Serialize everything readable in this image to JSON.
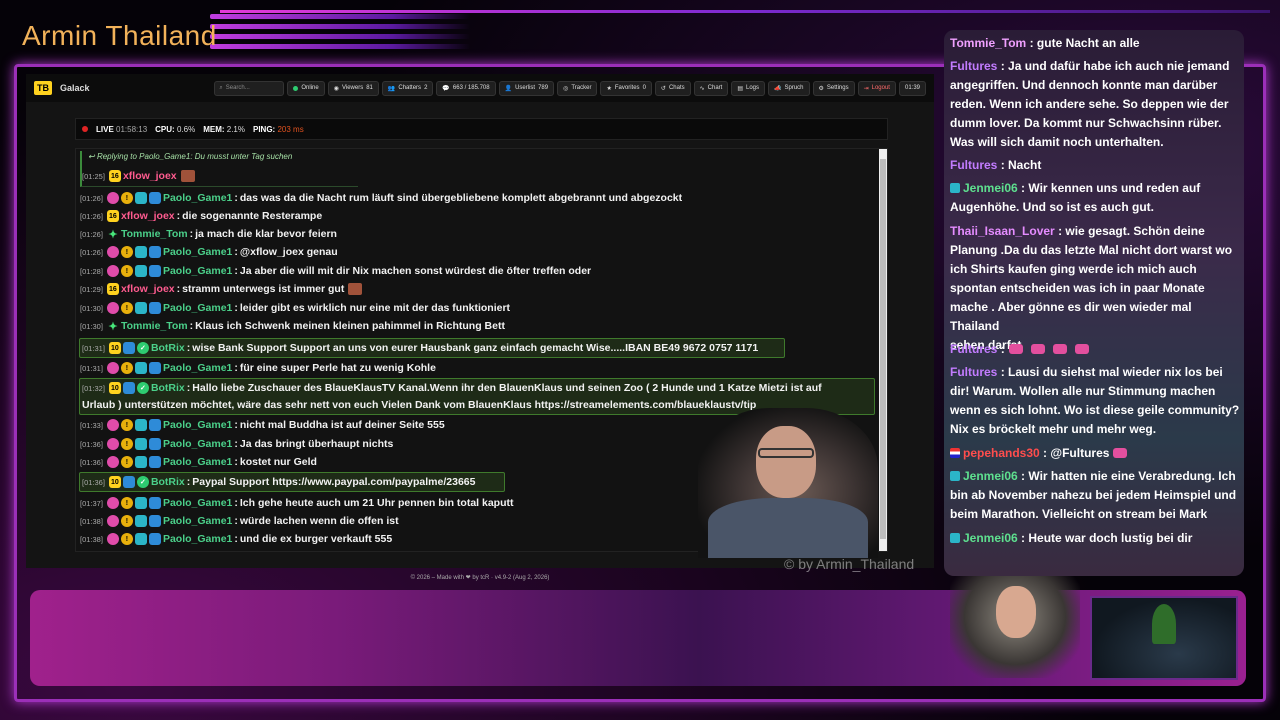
{
  "overlay": {
    "channel_title": "Armin Thailand",
    "watermark": "© by Armin_Thailand"
  },
  "app": {
    "brand": "Galack",
    "brand_logo": "TB",
    "search_placeholder": "Search...",
    "nav": {
      "online": "Online",
      "viewers": "Viewers",
      "viewers_count": "81",
      "chatters": "Chatters",
      "chatters_count": "2",
      "messages": "663 / 185.708",
      "userlist": "Userlist",
      "userlist_count": "789",
      "tracker": "Tracker",
      "favorites": "Favorites",
      "favorites_count": "0",
      "chats": "Chats",
      "chart": "Chart",
      "logs": "Logs",
      "spruch": "Spruch",
      "settings": "Settings",
      "logout": "Logout",
      "clock": "01:39"
    },
    "status": {
      "live": "LIVE",
      "live_time": "01:58:13",
      "cpu_label": "CPU:",
      "cpu_value": "0.6%",
      "mem_label": "MEM:",
      "mem_value": "2.1%",
      "ping_label": "PING:",
      "ping_value": "203 ms"
    },
    "reply": "Replying to Paolo_Game1: Du musst unter Tag suchen",
    "messages": [
      {
        "time": "[01:25]",
        "user": "xflow_joex",
        "text": ""
      },
      {
        "time": "[01:26]",
        "user": "Paolo_Game1",
        "text": "das was da die Nacht rum läuft sind übergebliebene komplett abgebrannt und abgezockt"
      },
      {
        "time": "[01:26]",
        "user": "xflow_joex",
        "text": "die sogenannte Resterampe"
      },
      {
        "time": "[01:26]",
        "user": "Tommie_Tom",
        "text": "ja mach die klar bevor feiern"
      },
      {
        "time": "[01:26]",
        "user": "Paolo_Game1",
        "text": "@xflow_joex genau"
      },
      {
        "time": "[01:28]",
        "user": "Paolo_Game1",
        "text": "Ja aber die will mit dir Nix machen sonst würdest die öfter treffen oder"
      },
      {
        "time": "[01:29]",
        "user": "xflow_joex",
        "text": "stramm unterwegs ist immer gut"
      },
      {
        "time": "[01:30]",
        "user": "Paolo_Game1",
        "text": "leider gibt es wirklich nur eine mit der das funktioniert"
      },
      {
        "time": "[01:30]",
        "user": "Tommie_Tom",
        "text": "Klaus ich Schwenk meinen kleinen pahimmel in Richtung Bett"
      },
      {
        "time": "[01:31]",
        "user": "BotRix",
        "text": "wise Bank Support Support an uns von eurer Hausbank ganz einfach gemacht Wise.....IBAN BE49 9672 0757 1171"
      },
      {
        "time": "[01:31]",
        "user": "Paolo_Game1",
        "text": "für eine super Perle hat zu wenig Kohle"
      },
      {
        "time": "[01:32]",
        "user": "BotRix",
        "text": "Hallo liebe Zuschauer des BlaueKlausTV Kanal.Wenn ihr den BlauenKlaus und seinen Zoo ( 2 Hunde und 1 Katze Mietzi ist auf",
        "text2": "Urlaub ) unterstützen möchtet, wäre das sehr nett von euch Vielen Dank vom BlauenKlaus https://streamelements.com/blaueklaustv/tip"
      },
      {
        "time": "[01:33]",
        "user": "Paolo_Game1",
        "text": "nicht mal Buddha ist auf deiner Seite 555"
      },
      {
        "time": "[01:36]",
        "user": "Paolo_Game1",
        "text": "Ja das bringt überhaupt nichts"
      },
      {
        "time": "[01:36]",
        "user": "Paolo_Game1",
        "text": "kostet nur Geld"
      },
      {
        "time": "[01:36]",
        "user": "BotRix",
        "text": "Paypal Support https://www.paypal.com/paypalme/23665"
      },
      {
        "time": "[01:37]",
        "user": "Paolo_Game1",
        "text": "Ich gehe heute auch um 21 Uhr pennen bin total kaputt"
      },
      {
        "time": "[01:38]",
        "user": "Paolo_Game1",
        "text": "würde lachen wenn die offen ist"
      },
      {
        "time": "[01:38]",
        "user": "Paolo_Game1",
        "text": "und die ex burger verkauft 555"
      }
    ],
    "footer": "© 2026 – Made with ❤ by tcR · v4.9-2 (Aug 2, 2026)"
  },
  "side_chat": [
    {
      "user": "Tommie_Tom",
      "lines": [
        ": gute Nacht an alle"
      ]
    },
    {
      "user": "Fultures",
      "lines": [
        ": Ja und dafür habe ich auch nie jemand",
        "angegriffen. Und dennoch konnte man darüber",
        "reden. Wenn ich andere sehe. So deppen wie der",
        "dumm lover. Da kommt nur Schwachsinn rüber.",
        "Was will sich damit noch unterhalten."
      ]
    },
    {
      "user": "Fultures",
      "lines": [
        ": Nacht"
      ]
    },
    {
      "user": "Jenmei06",
      "lines": [
        ": Wir kennen uns und reden auf",
        "Augenhöhe. Und so ist es auch gut."
      ]
    },
    {
      "user": "Thaii_Isaan_Lover",
      "lines": [
        ": wie gesagt. Schön deine",
        "Planung .Da du das letzte Mal nicht dort warst wo",
        "ich Shirts kaufen ging werde ich mich auch",
        "spontan entscheiden was ich in paar Monate",
        "mache . Aber gönne es dir wen wieder mal Thailand",
        "sehen darfst"
      ]
    },
    {
      "user": "Fultures",
      "lines": [
        ":"
      ]
    },
    {
      "user": "Fultures",
      "lines": [
        ": Lausi du siehst mal wieder nix los bei",
        "dir! Warum. Wollen alle nur Stimmung machen",
        "wenn es sich lohnt. Wo ist diese geile community?",
        "Nix es bröckelt mehr und mehr weg."
      ]
    },
    {
      "user": "pepehands30",
      "lines": [
        ": @Fultures"
      ]
    },
    {
      "user": "Jenmei06",
      "lines": [
        ": Wir hatten nie eine Verabredung. Ich",
        "bin ab November nahezu bei jedem Heimspiel und",
        "beim Marathon. Vielleicht on stream bei Mark"
      ]
    },
    {
      "user": "Jenmei06",
      "lines": [
        ": Heute war doch lustig bei dir"
      ]
    }
  ]
}
